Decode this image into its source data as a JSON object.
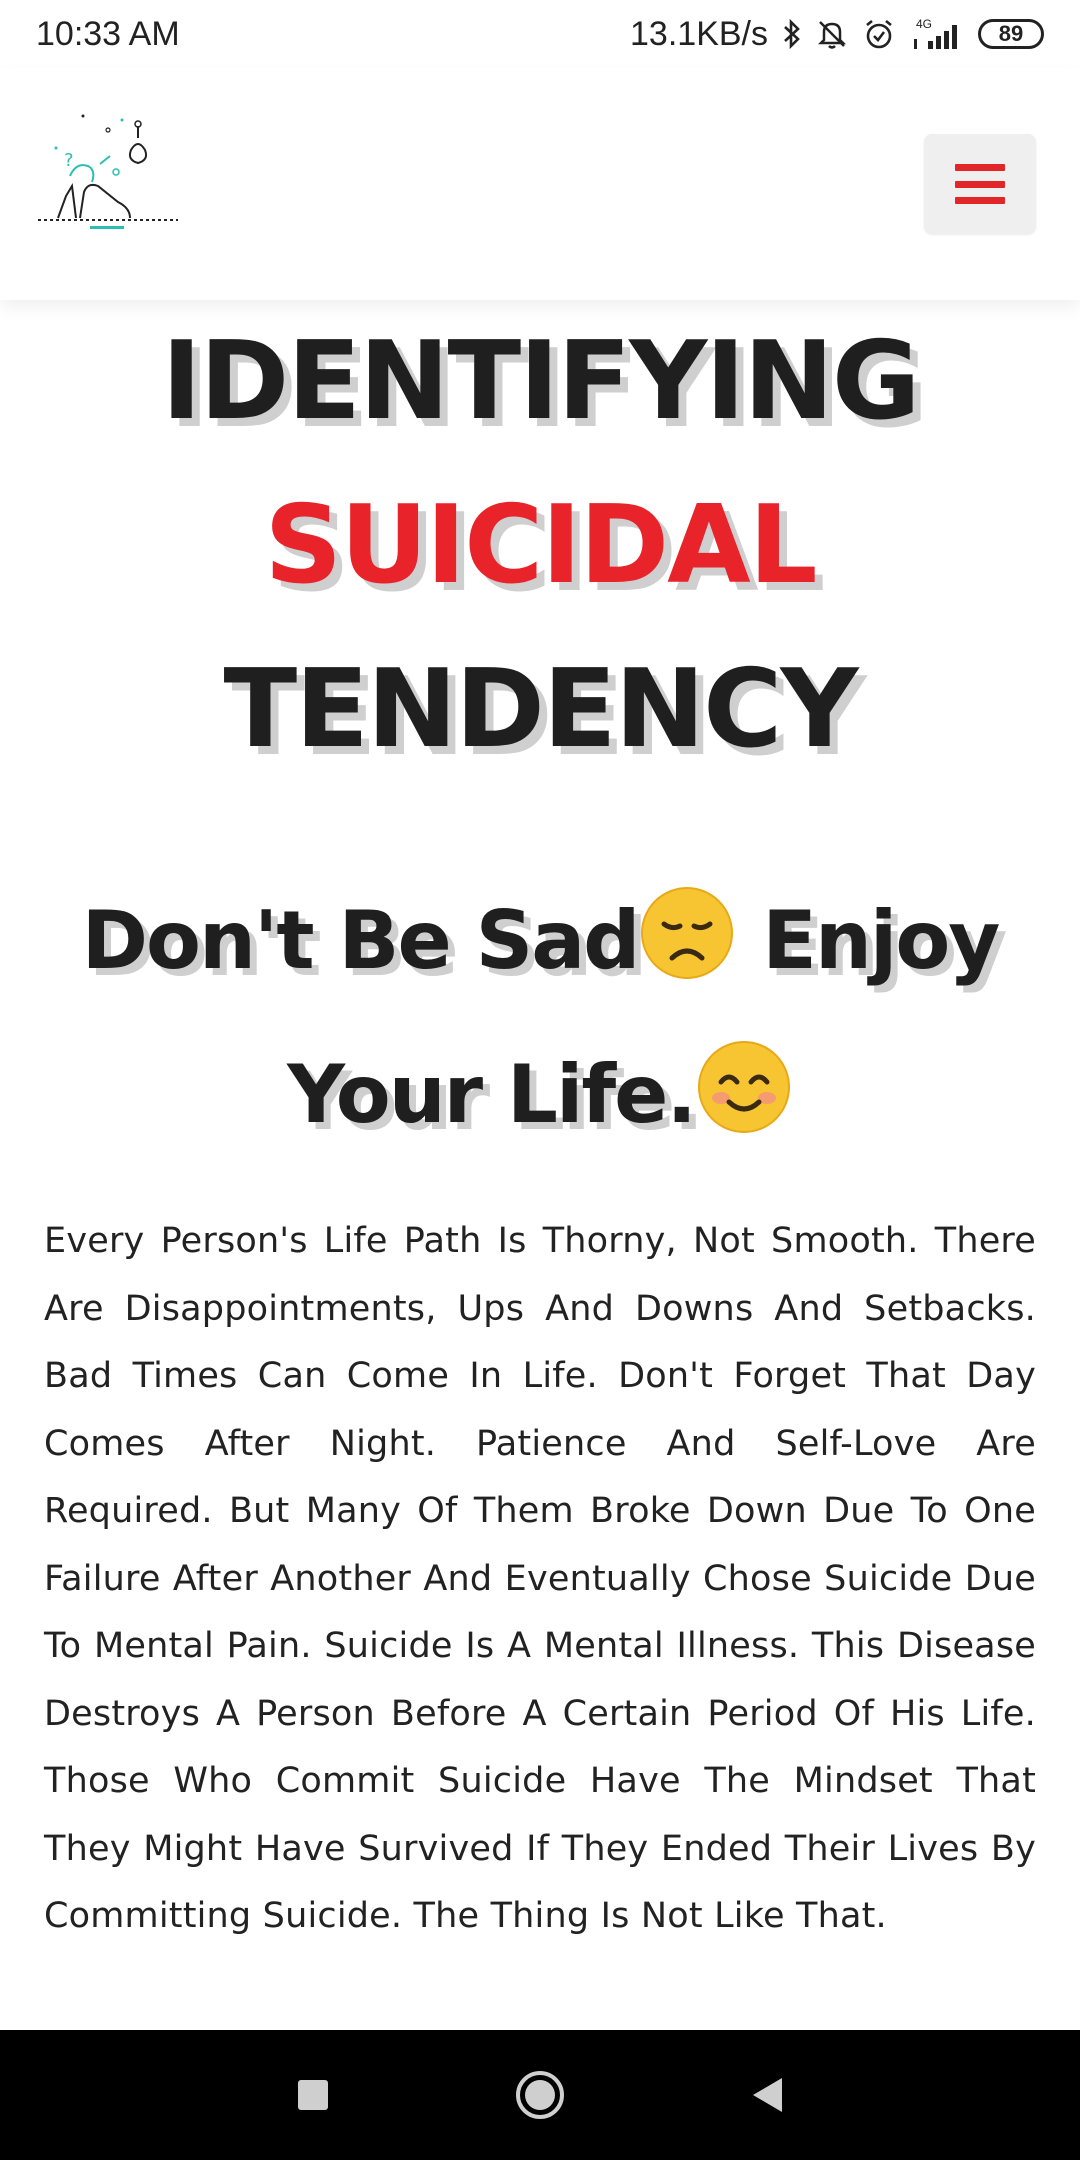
{
  "status_bar": {
    "time": "10:33 AM",
    "speed": "13.1KB/s",
    "network": "4G",
    "battery": "89"
  },
  "header": {
    "menu_icon": "hamburger-menu-icon",
    "logo_icon": "suicide-awareness-logo-icon",
    "accent_color": "#e8232a"
  },
  "hero": {
    "line1": "IDENTIFYING",
    "line2": "SUICIDAL",
    "line3": "TENDENCY"
  },
  "subtitle": {
    "part1": "Don't Be Sad",
    "part2": " Enjoy",
    "part3": "Your Life.",
    "emoji1": "sad-face-emoji",
    "emoji2": "smiling-face-emoji"
  },
  "body": {
    "paragraph": "Every Person's Life Path Is Thorny, Not Smooth. There Are Disappointments, Ups And Downs And Setbacks. Bad Times Can Come In Life. Don't Forget That Day Comes After Night. Patience And Self-Love Are Required. But Many Of Them Broke Down Due To One Failure After Another And Eventually Chose Suicide Due To Mental Pain. Suicide Is A Mental Illness. This Disease Destroys A Person Before A Certain Period Of His Life. Those Who Commit Suicide Have The Mindset That They Might Have Survived If They Ended Their Lives By Committing Suicide. The Thing Is Not Like That."
  },
  "nav_bar": {
    "recents_icon": "square-recents-icon",
    "home_icon": "circle-home-icon",
    "back_icon": "triangle-back-icon"
  }
}
